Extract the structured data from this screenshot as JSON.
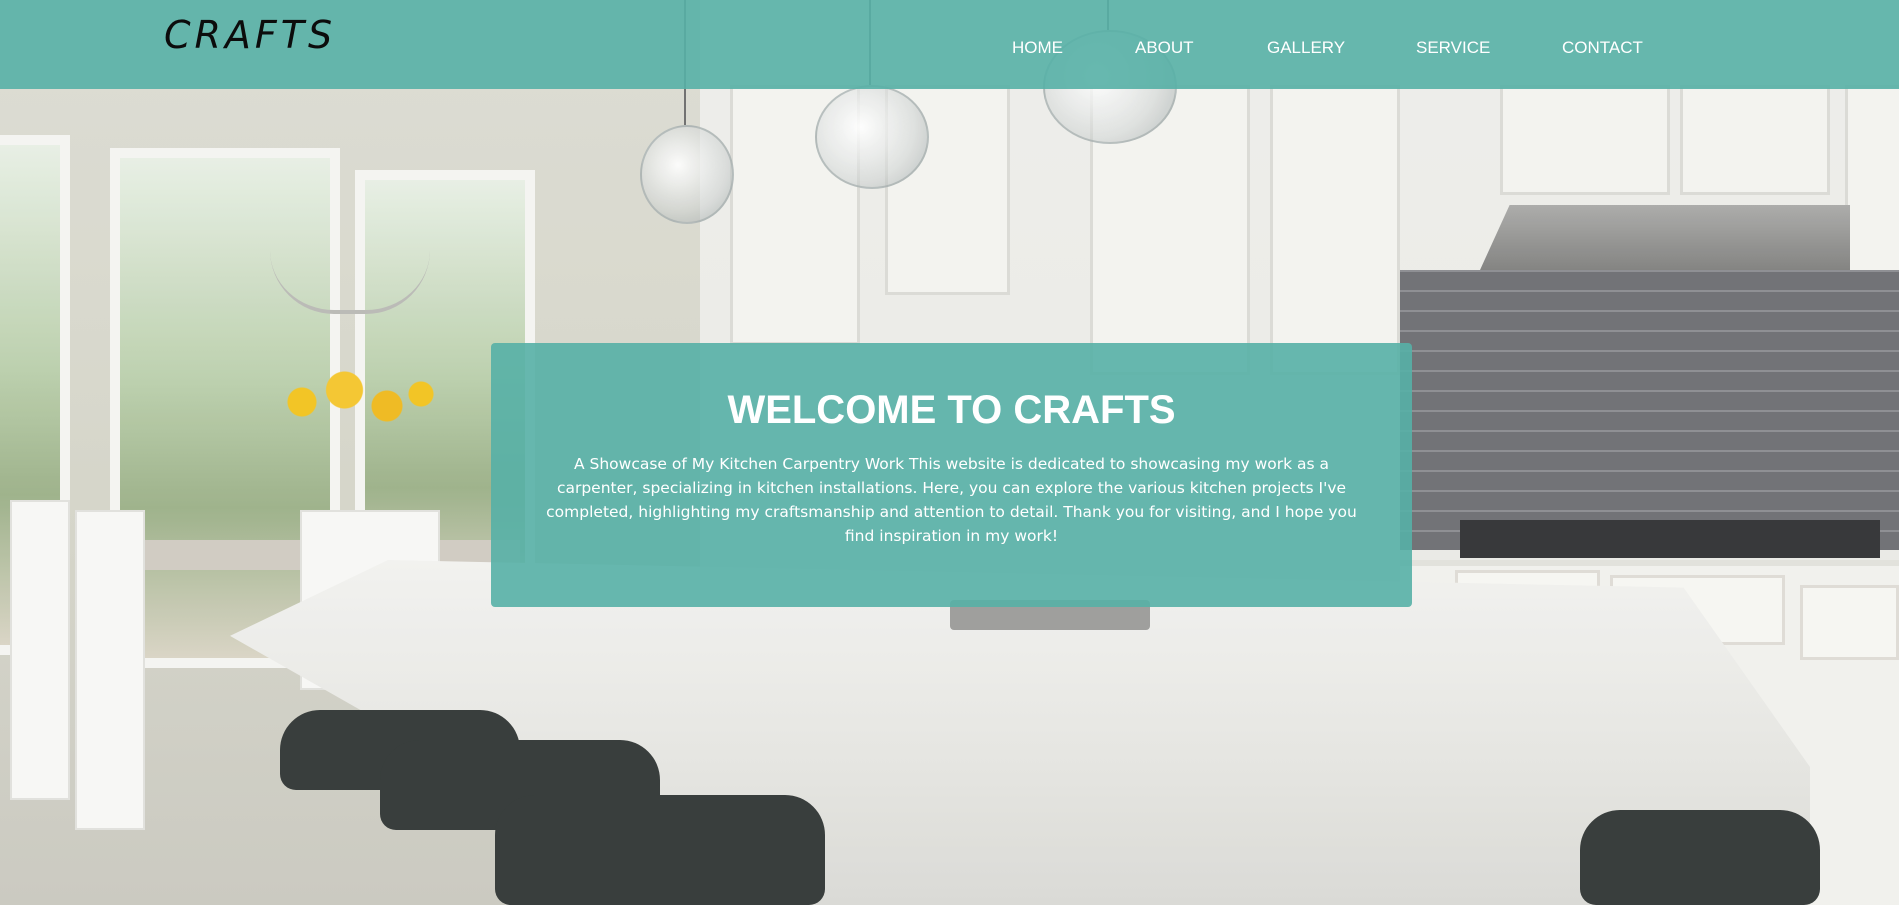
{
  "header": {
    "logo_text": "CRAFTS",
    "nav": [
      {
        "label": "HOME"
      },
      {
        "label": "ABOUT"
      },
      {
        "label": "GALLERY"
      },
      {
        "label": "SERVICE"
      },
      {
        "label": "CONTACT"
      }
    ]
  },
  "hero": {
    "background_subject": "kitchen-photo",
    "card": {
      "title": "WELCOME TO CRAFTS",
      "text": "A Showcase of My Kitchen Carpentry Work This website is dedicated to showcasing my work as a carpenter, specializing in kitchen installations. Here, you can explore the various kitchen projects I've completed, highlighting my craftsmanship and attention to detail. Thank you for visiting, and I hope you find inspiration in my work!"
    }
  },
  "colors": {
    "accent_teal": "#57b0a6",
    "text_white": "#ffffff",
    "logo_black": "#0c0c0c"
  }
}
